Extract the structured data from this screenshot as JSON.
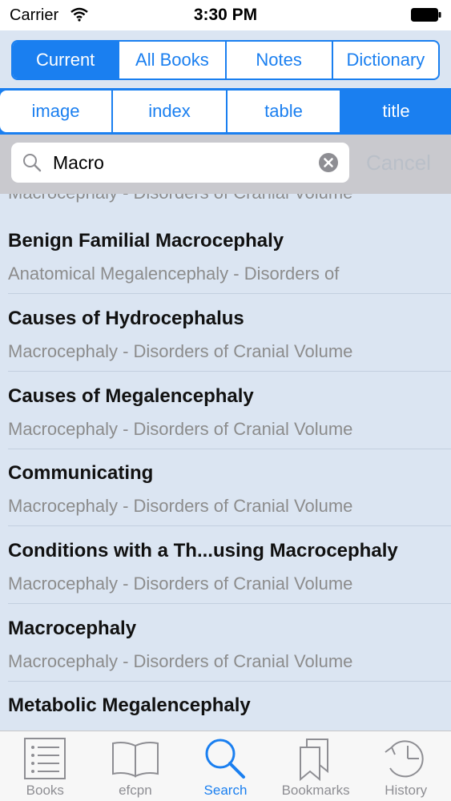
{
  "status_bar": {
    "carrier": "Carrier",
    "time": "3:30 PM"
  },
  "scope_tabs": [
    {
      "label": "Current",
      "selected": true
    },
    {
      "label": "All Books",
      "selected": false
    },
    {
      "label": "Notes",
      "selected": false
    },
    {
      "label": "Dictionary",
      "selected": false
    }
  ],
  "type_tabs": [
    {
      "label": "image",
      "selected": false
    },
    {
      "label": "index",
      "selected": false
    },
    {
      "label": "table",
      "selected": false
    },
    {
      "label": "title",
      "selected": true
    }
  ],
  "search": {
    "value": "Macro",
    "cancel_label": "Cancel"
  },
  "results": {
    "partial_subtitle": "Macrocephaly - Disorders of Cranial Volume",
    "items": [
      {
        "title": "Benign Familial Macrocephaly",
        "subtitle": "Anatomical Megalencephaly - Disorders of"
      },
      {
        "title": "Causes of Hydrocephalus",
        "subtitle": "Macrocephaly - Disorders of Cranial Volume"
      },
      {
        "title": "Causes of Megalencephaly",
        "subtitle": "Macrocephaly - Disorders of Cranial Volume"
      },
      {
        "title": "Communicating",
        "subtitle": "Macrocephaly - Disorders of Cranial Volume"
      },
      {
        "title": "Conditions with a Th...using Macrocephaly",
        "subtitle": "Macrocephaly - Disorders of Cranial Volume"
      },
      {
        "title": "Macrocephaly",
        "subtitle": "Macrocephaly - Disorders of Cranial Volume"
      },
      {
        "title": "Metabolic Megalencephaly",
        "subtitle": ""
      }
    ]
  },
  "tab_bar": [
    {
      "label": "Books",
      "icon": "list-icon",
      "selected": false
    },
    {
      "label": "efcpn",
      "icon": "book-icon",
      "selected": false
    },
    {
      "label": "Search",
      "icon": "search-icon",
      "selected": true
    },
    {
      "label": "Bookmarks",
      "icon": "bookmarks-icon",
      "selected": false
    },
    {
      "label": "History",
      "icon": "history-icon",
      "selected": false
    }
  ],
  "colors": {
    "accent": "#1a7ff0",
    "list_background": "#dbe5f2",
    "search_area": "#c9c9ce"
  }
}
